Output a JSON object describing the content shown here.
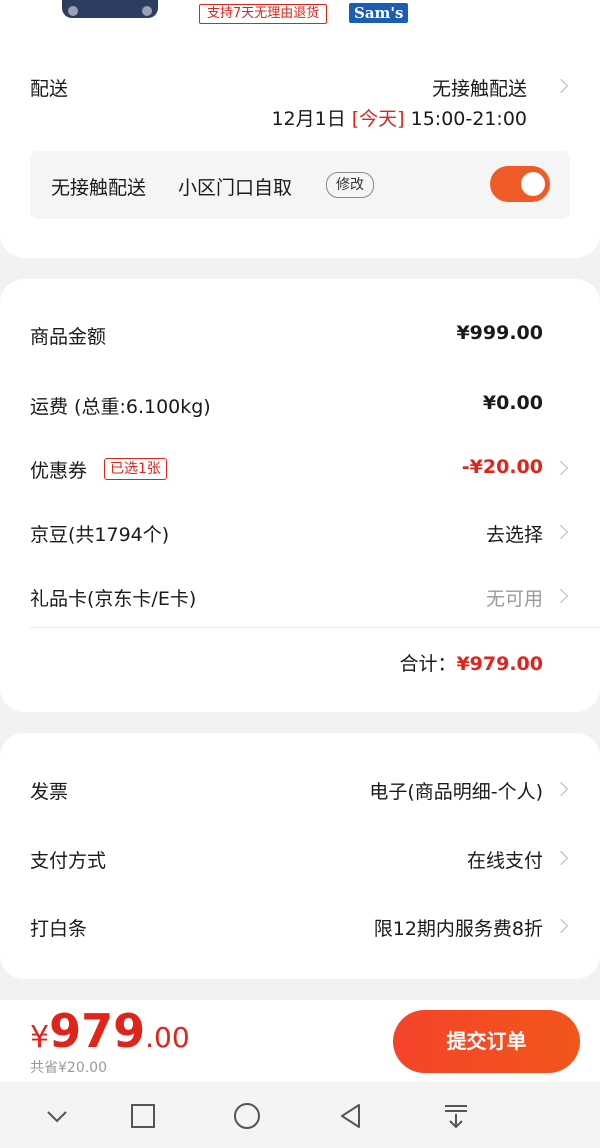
{
  "product": {
    "return_tag": "支持7天无理由退货",
    "brand_tag": "Sam's"
  },
  "delivery": {
    "label": "配送",
    "method": "无接触配送",
    "date": "12月1日",
    "today": "[今天]",
    "time": "15:00-21:00",
    "option_contactless": "无接触配送",
    "option_pickup": "小区门口自取",
    "edit_label": "修改",
    "toggle_on": true
  },
  "amounts": {
    "goods_label": "商品金额",
    "goods_value": "¥999.00",
    "shipping_label": "运费 (总重:6.100kg)",
    "shipping_value": "¥0.00",
    "coupon_label": "优惠券",
    "coupon_tag": "已选1张",
    "coupon_value": "-¥20.00",
    "jd_beans_label": "京豆(共1794个)",
    "jd_beans_value": "去选择",
    "gift_card_label": "礼品卡(京东卡/E卡)",
    "gift_card_value": "无可用",
    "total_label": "合计：",
    "total_value": "¥979.00"
  },
  "payment": {
    "invoice_label": "发票",
    "invoice_value": "电子(商品明细-个人)",
    "method_label": "支付方式",
    "method_value": "在线支付",
    "baitiao_label": "打白条",
    "baitiao_value": "限12期内服务费8折"
  },
  "bottom": {
    "currency": "¥",
    "price_int": "979",
    "price_dec": ".00",
    "saved": "共省¥20.00",
    "submit_label": "提交订单"
  },
  "colors": {
    "accent": "#e2231a",
    "button": "#f5432a",
    "toggle": "#f05a27"
  },
  "navbar": [
    "chevron-down-icon",
    "square-icon",
    "circle-icon",
    "back-triangle-icon",
    "download-icon"
  ]
}
